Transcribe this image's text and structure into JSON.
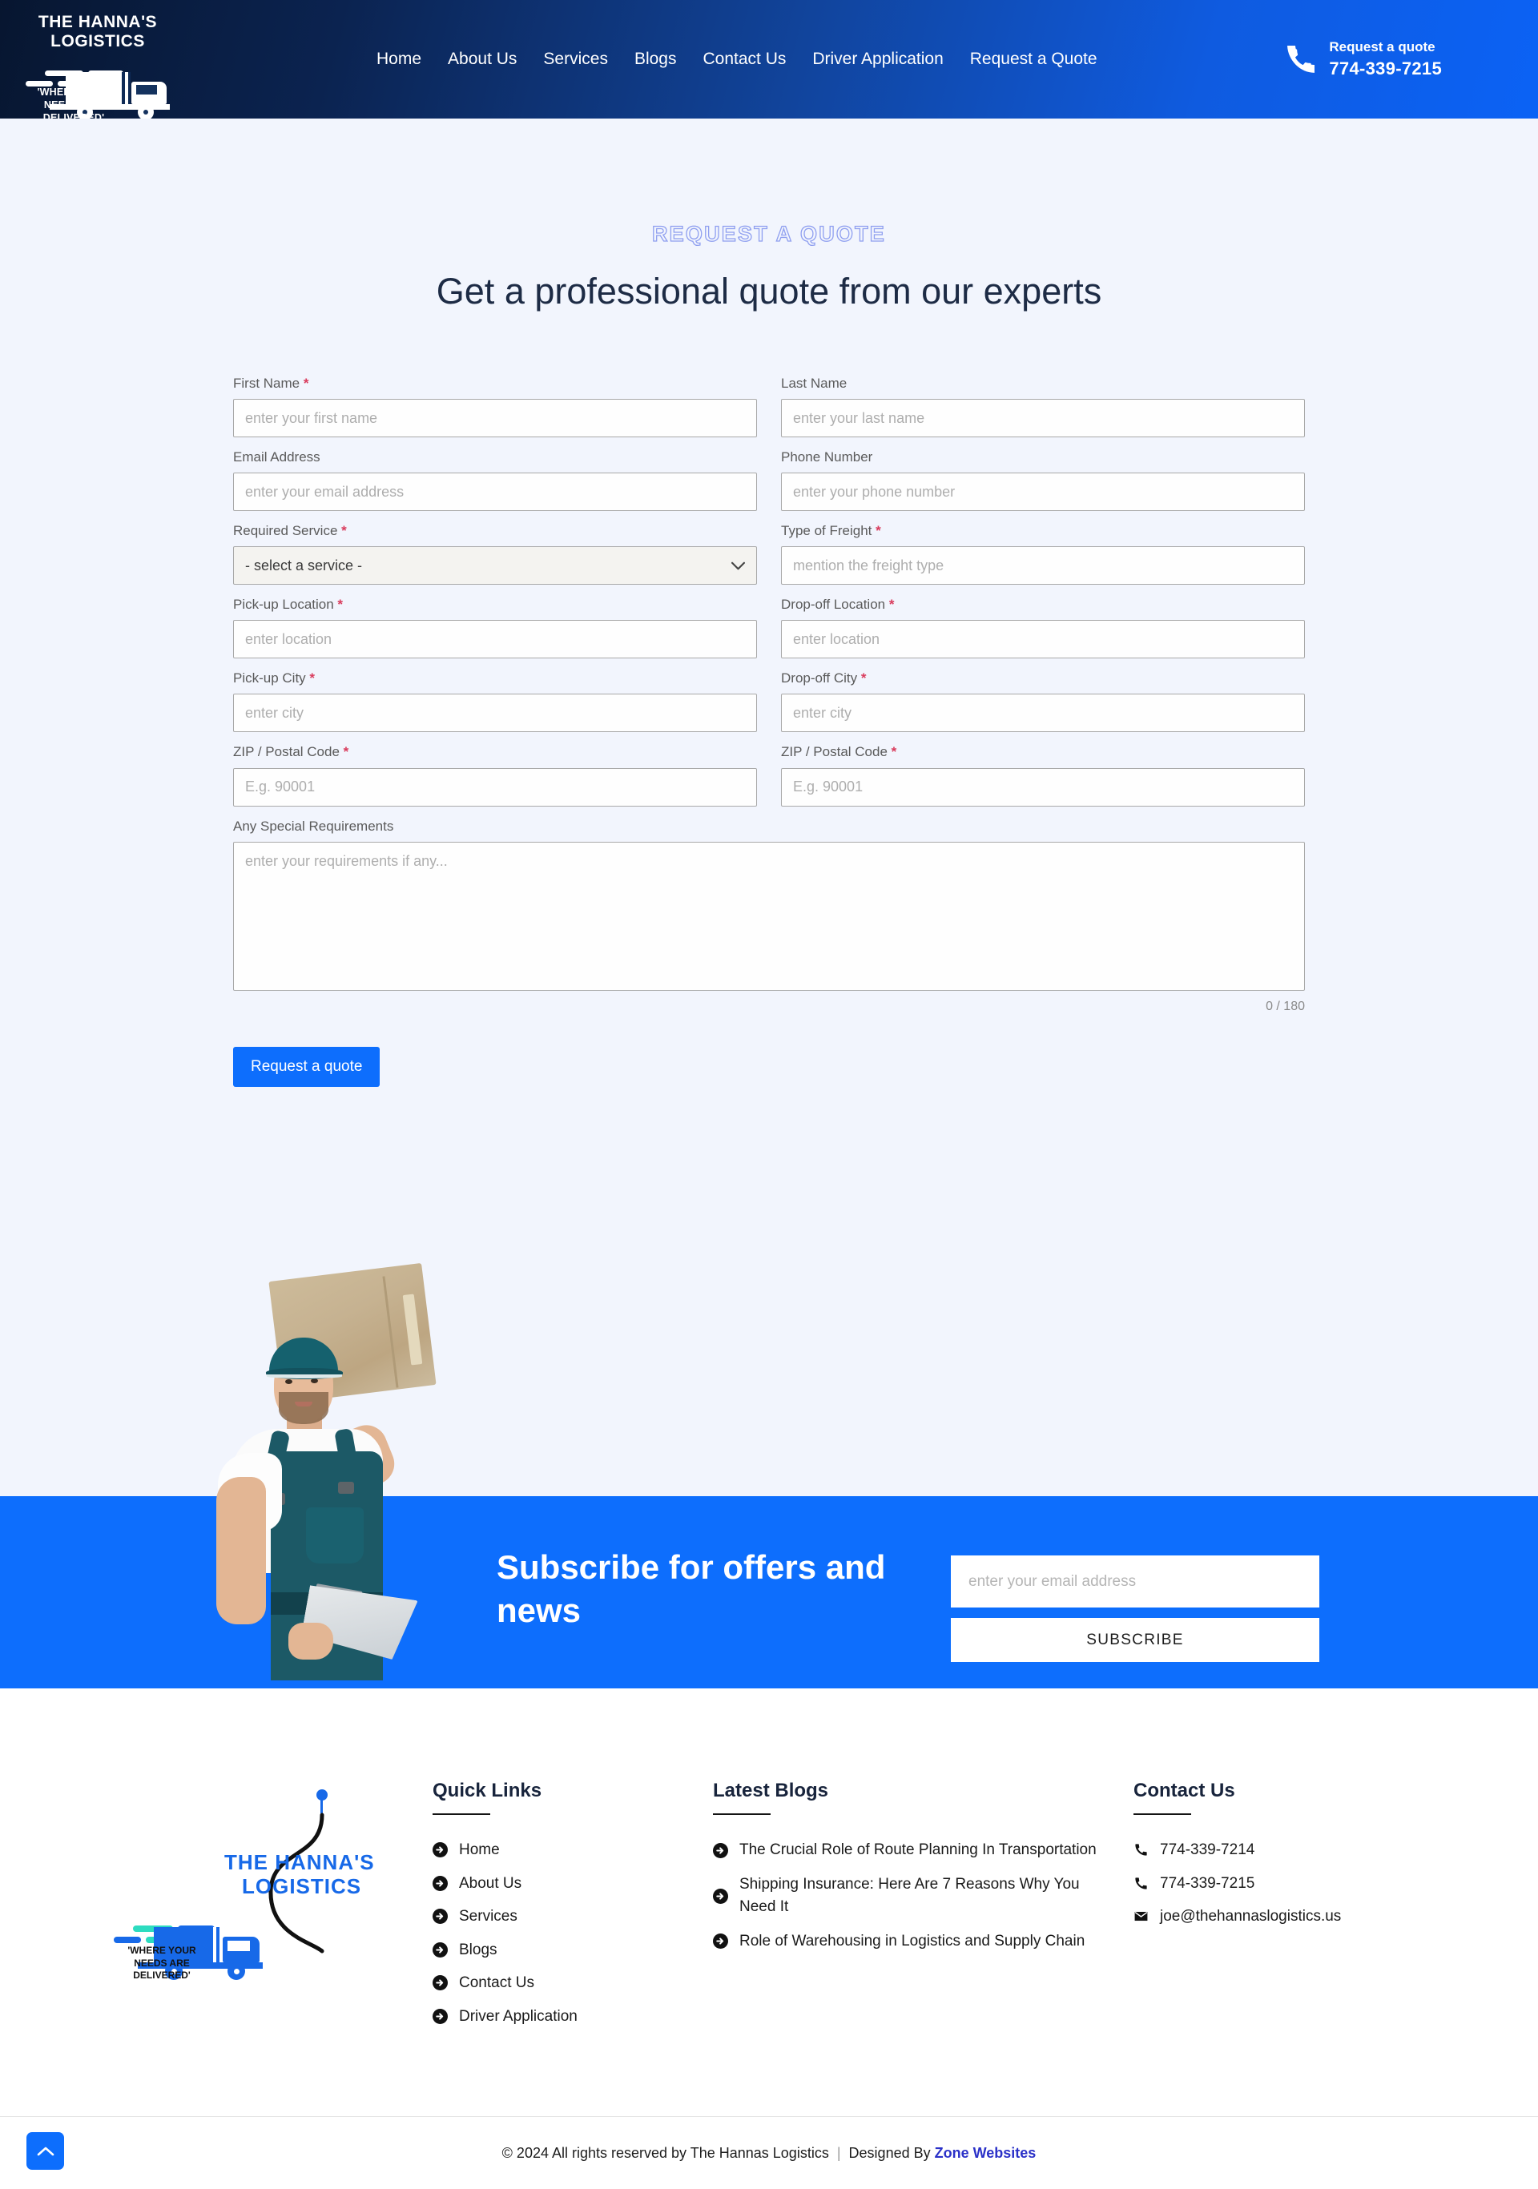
{
  "header": {
    "logo": {
      "line1": "THE HANNA'S",
      "line2": "LOGISTICS",
      "tagline": "'WHERE YOUR NEEDS ARE DELIVERED'"
    },
    "nav": [
      {
        "label": "Home"
      },
      {
        "label": "About Us"
      },
      {
        "label": "Services"
      },
      {
        "label": "Blogs"
      },
      {
        "label": "Contact Us"
      },
      {
        "label": "Driver Application"
      },
      {
        "label": "Request a Quote"
      }
    ],
    "cta": {
      "label": "Request a quote",
      "phone": "774-339-7215",
      "icon": "phone-icon"
    }
  },
  "main": {
    "eyebrow": "REQUEST A QUOTE",
    "headline": "Get a professional quote from our experts",
    "form": {
      "first_name": {
        "label": "First Name",
        "required": true,
        "placeholder": "enter your first name",
        "value": ""
      },
      "last_name": {
        "label": "Last Name",
        "required": false,
        "placeholder": "enter your last name",
        "value": ""
      },
      "email": {
        "label": "Email Address",
        "required": false,
        "placeholder": "enter your email address",
        "value": ""
      },
      "phone": {
        "label": "Phone Number",
        "required": false,
        "placeholder": "enter your phone number",
        "value": ""
      },
      "service": {
        "label": "Required Service",
        "required": true,
        "selected": "- select a service -"
      },
      "freight": {
        "label": "Type of Freight",
        "required": true,
        "placeholder": "mention the freight type",
        "value": ""
      },
      "pickup_location": {
        "label": "Pick-up Location",
        "required": true,
        "placeholder": "enter location",
        "value": ""
      },
      "dropoff_location": {
        "label": "Drop-off Location",
        "required": true,
        "placeholder": "enter location",
        "value": ""
      },
      "pickup_city": {
        "label": "Pick-up City",
        "required": true,
        "placeholder": "enter city",
        "value": ""
      },
      "dropoff_city": {
        "label": "Drop-off City",
        "required": true,
        "placeholder": "enter city",
        "value": ""
      },
      "pickup_zip": {
        "label": "ZIP / Postal Code",
        "required": true,
        "placeholder": "E.g. 90001",
        "value": ""
      },
      "dropoff_zip": {
        "label": "ZIP / Postal Code",
        "required": true,
        "placeholder": "E.g. 90001",
        "value": ""
      },
      "requirements": {
        "label": "Any Special Requirements",
        "required": false,
        "placeholder": "enter your requirements if any...",
        "value": "",
        "counter": "0 / 180"
      },
      "submit_label": "Request a quote"
    }
  },
  "subscribe": {
    "title": "Subscribe for offers and news",
    "email_placeholder": "enter your email address",
    "email_value": "",
    "button_label": "SUBSCRIBE"
  },
  "footer": {
    "logo": {
      "line1": "THE HANNA'S",
      "line2": "LOGISTICS",
      "tagline": "'WHERE YOUR NEEDS ARE DELIVERED'"
    },
    "quick_links": {
      "title": "Quick Links",
      "items": [
        {
          "label": "Home",
          "icon": "arrow-circle-right-icon"
        },
        {
          "label": "About Us",
          "icon": "arrow-circle-right-icon"
        },
        {
          "label": "Services",
          "icon": "arrow-circle-right-icon"
        },
        {
          "label": "Blogs",
          "icon": "arrow-circle-right-icon"
        },
        {
          "label": "Contact Us",
          "icon": "arrow-circle-right-icon"
        },
        {
          "label": "Driver Application",
          "icon": "arrow-circle-right-icon"
        }
      ]
    },
    "latest_blogs": {
      "title": "Latest Blogs",
      "items": [
        {
          "label": "The Crucial Role of Route Planning In Transportation",
          "icon": "arrow-circle-right-icon"
        },
        {
          "label": "Shipping Insurance: Here Are 7 Reasons Why You Need It",
          "icon": "arrow-circle-right-icon"
        },
        {
          "label": "Role of Warehousing in Logistics and Supply Chain",
          "icon": "arrow-circle-right-icon"
        }
      ]
    },
    "contact": {
      "title": "Contact Us",
      "items": [
        {
          "label": "774-339-7214",
          "icon": "phone-icon"
        },
        {
          "label": "774-339-7215",
          "icon": "phone-icon"
        },
        {
          "label": "joe@thehannaslogistics.us",
          "icon": "envelope-icon"
        }
      ]
    }
  },
  "bottom": {
    "copyright": "© 2024 All rights reserved by The Hannas Logistics",
    "separator": "|",
    "designed_by": "Designed By",
    "brand": "Zone Websites",
    "scroll_top_icon": "chevron-up-icon"
  },
  "colors": {
    "brand_blue": "#0d6efd",
    "header_dark": "#071630",
    "body_bg": "#f2f5fd",
    "required_red": "#d93b5c",
    "logo_blue": "#1769e8",
    "logo_teal": "#2ddcc0",
    "designer_link": "#2b31c8"
  }
}
